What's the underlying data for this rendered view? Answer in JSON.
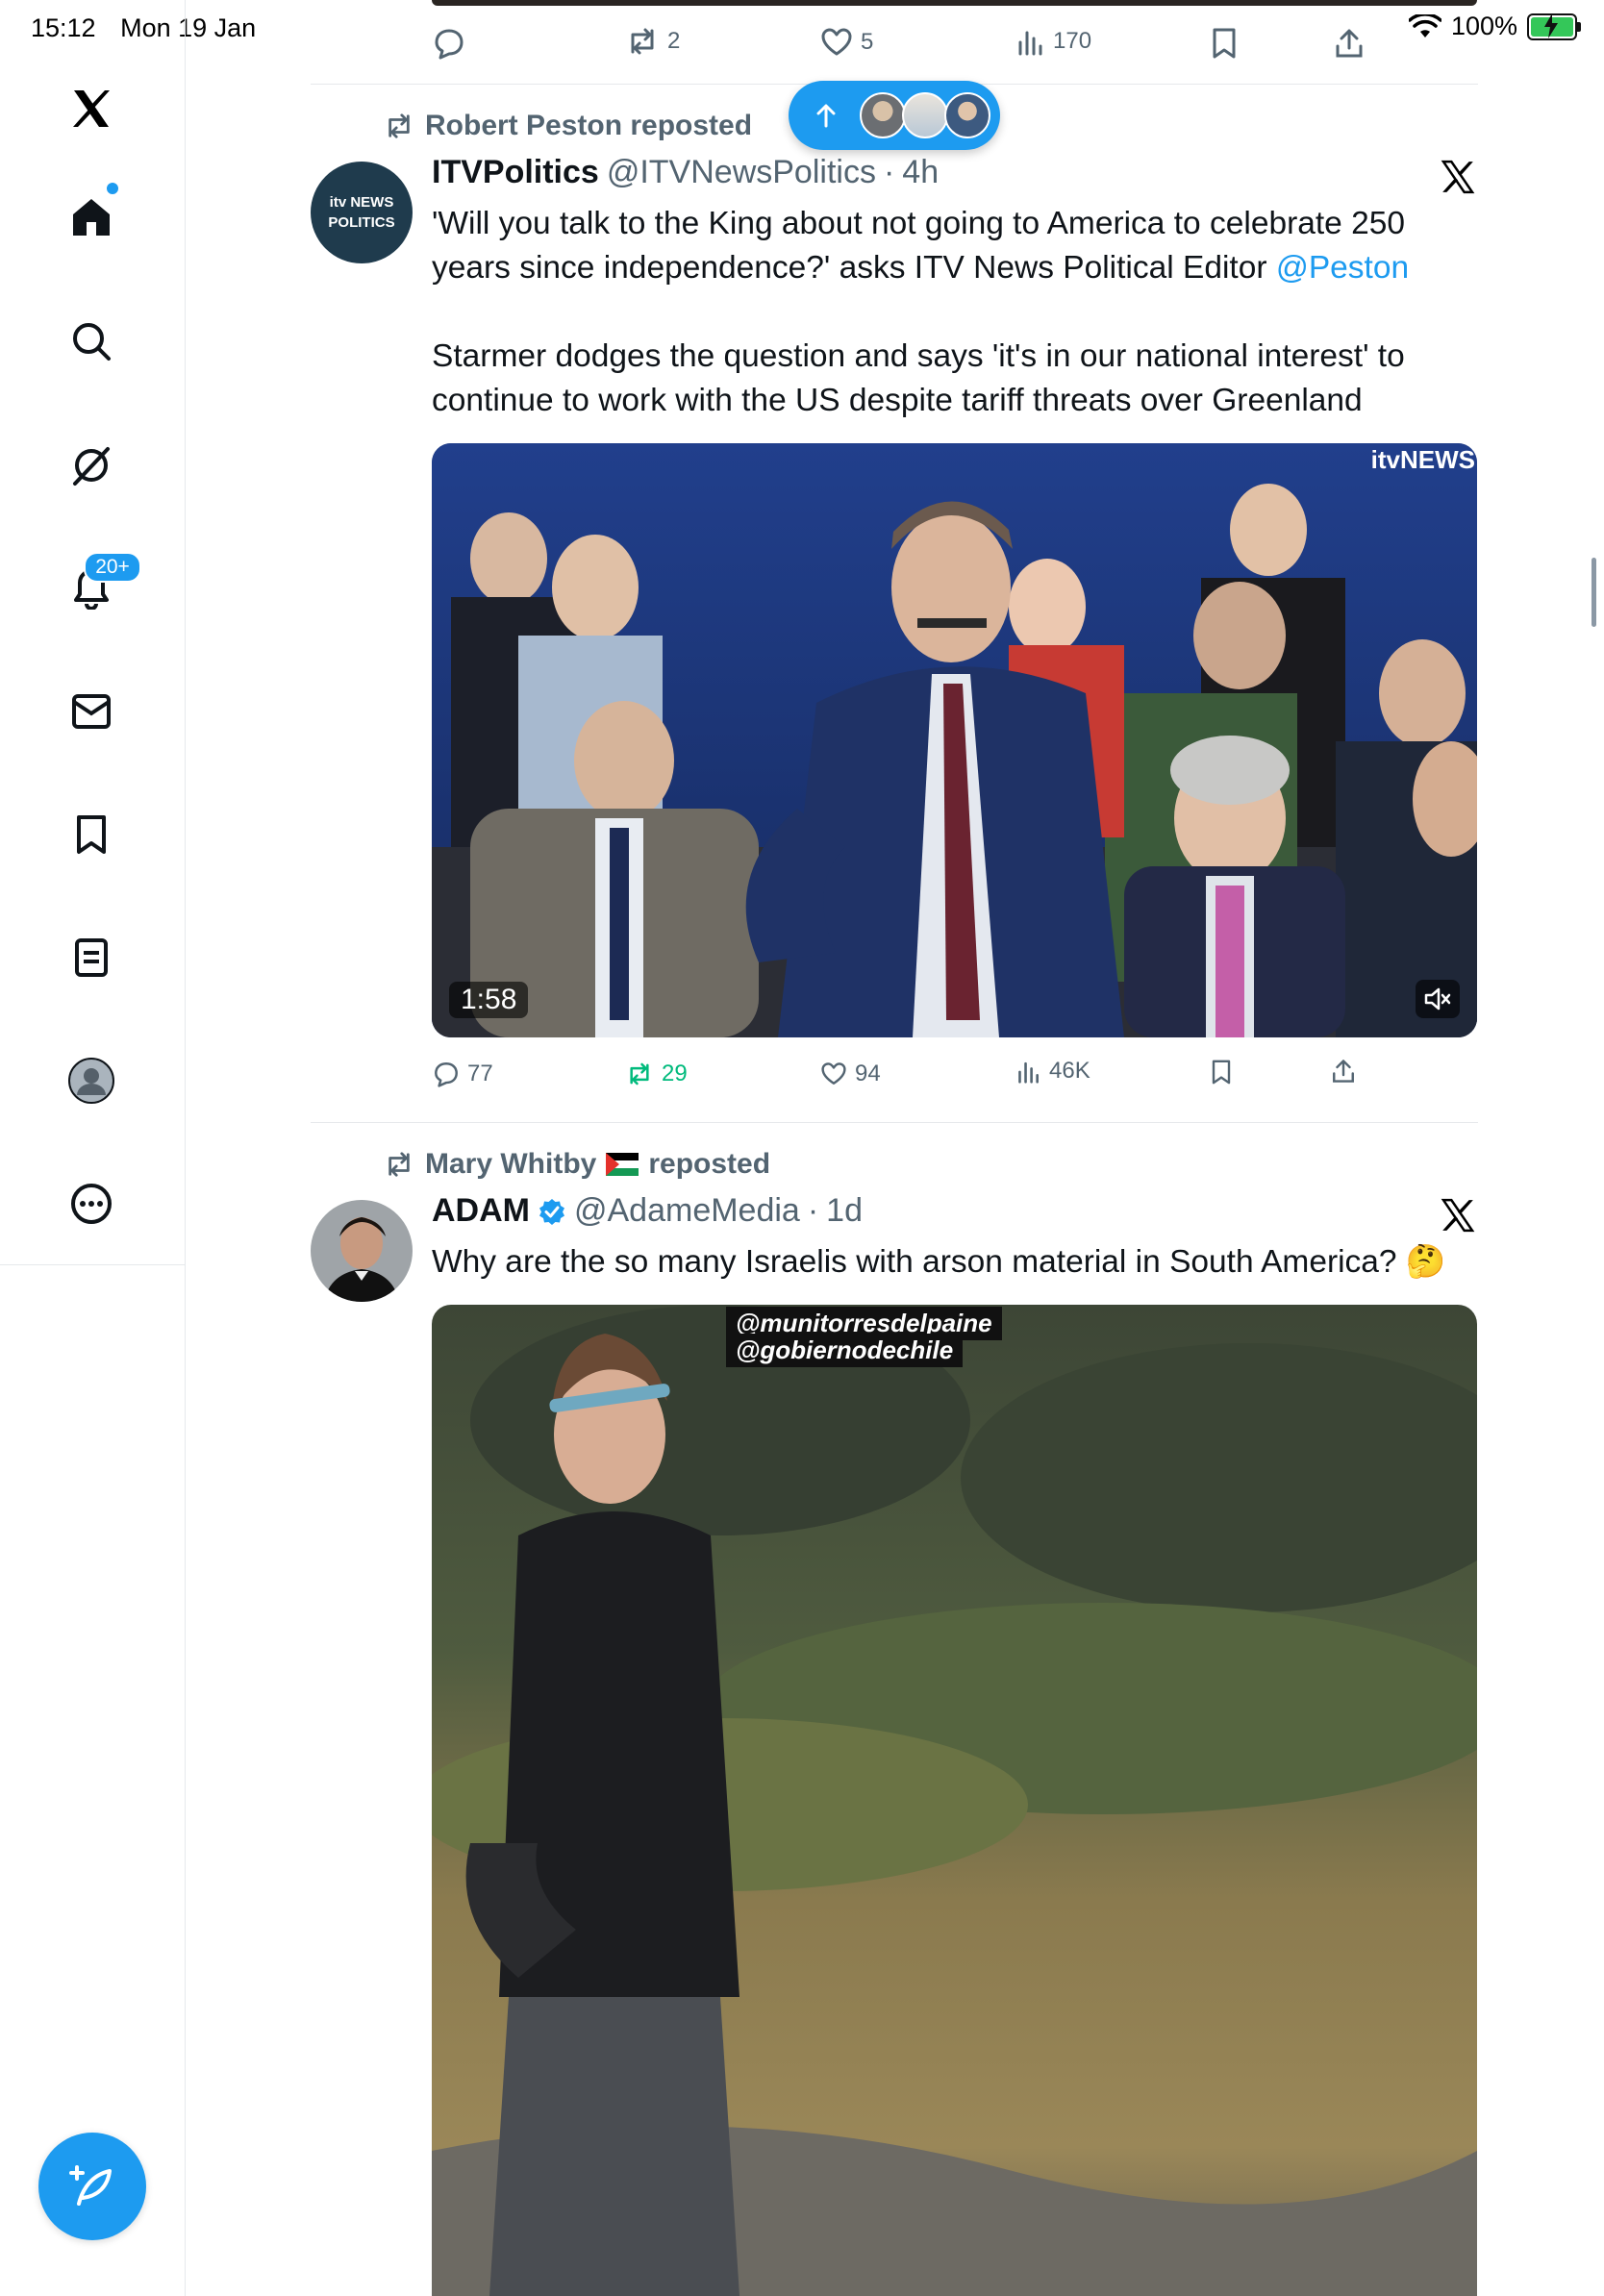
{
  "status_bar": {
    "time": "15:12",
    "date": "Mon 19 Jan",
    "battery": "100%"
  },
  "sidebar": {
    "items": [
      {
        "name": "x-logo"
      },
      {
        "name": "home"
      },
      {
        "name": "explore"
      },
      {
        "name": "grok"
      },
      {
        "name": "notifications",
        "badge": "20+"
      },
      {
        "name": "messages"
      },
      {
        "name": "bookmarks"
      },
      {
        "name": "lists"
      },
      {
        "name": "profile"
      },
      {
        "name": "more"
      }
    ]
  },
  "accent": "#1d9bf0",
  "top_actions": {
    "reposts": "2",
    "likes": "5",
    "views": "170"
  },
  "new_posts_pill": {
    "icon": "arrow-up-icon"
  },
  "tweets": [
    {
      "reposted_by": "Robert Peston reposted",
      "name": "ITVPolitics",
      "handle": "@ITVNewsPolitics",
      "time": "4h",
      "avatar_line1": "itv NEWS",
      "avatar_line2": "POLITICS",
      "text1_before": "'Will you talk to the King about not going to America to celebrate 250 years since independence?' asks ITV News Political Editor ",
      "text1_mention": "@Peston",
      "text2": "Starmer dodges the question and says 'it's in our national interest' to continue to work with the US despite tariff threats over Greenland",
      "video_duration": "1:58",
      "video_brand": "itvNEWS",
      "replies": "77",
      "reposts": "29",
      "likes": "94",
      "views": "46K"
    },
    {
      "reposted_by": "Mary Whitby",
      "reposted_suffix": "reposted",
      "name": "ADAM",
      "handle": "@AdameMedia",
      "time": "1d",
      "text": "Why are the so many Israelis with arson material in South America? 🤔",
      "video_tag1": "@munitorresdelpaine",
      "video_tag2": "@gobiernodechile"
    }
  ]
}
